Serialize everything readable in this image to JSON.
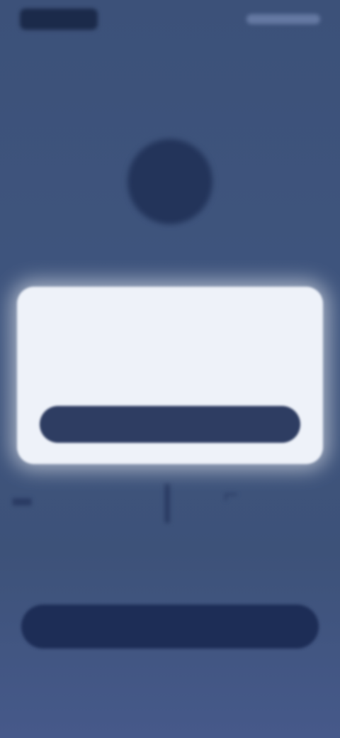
{
  "status_bar": {
    "time": "",
    "icons": [
      "signal-icon",
      "wifi-icon",
      "battery-icon"
    ]
  },
  "profile": {
    "avatar_icon": "avatar-icon",
    "stats_icons": [
      "stat-icon",
      "stat-icon",
      "stat-icon"
    ]
  },
  "main": {
    "primary_button_label": "",
    "footer_link": ""
  },
  "dialog": {
    "title": "",
    "message": "",
    "button_label": ""
  },
  "colors": {
    "background": "#3f557e",
    "dialog_background": "#eef2f9",
    "dialog_button": "#2e3d62",
    "primary_button": "#1d2d56"
  }
}
